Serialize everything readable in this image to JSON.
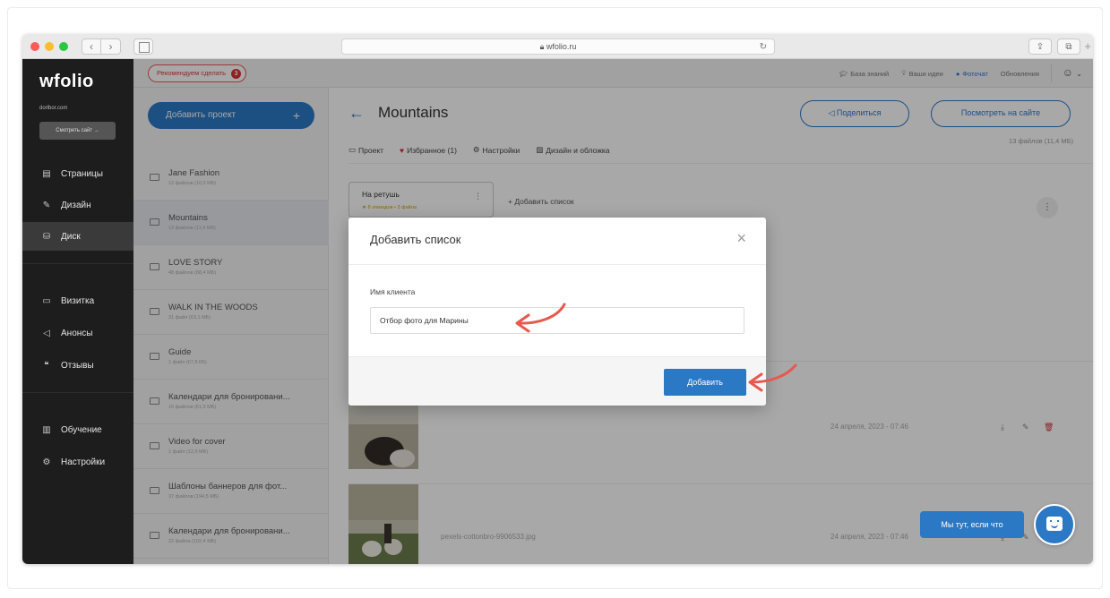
{
  "browser": {
    "url": "wfolio.ru",
    "lock_icon": "lock-icon"
  },
  "leftnav": {
    "logo": "wfolio",
    "domain": "dorlbor.com",
    "view_site": "Смотреть сайт →",
    "items": [
      {
        "label": "Страницы",
        "icon": "page-icon"
      },
      {
        "label": "Дизайн",
        "icon": "brush-icon"
      },
      {
        "label": "Диск",
        "icon": "disk-icon",
        "active": true
      },
      {
        "label": "Визитка",
        "icon": "card-icon"
      },
      {
        "label": "Анонсы",
        "icon": "megaphone-icon"
      },
      {
        "label": "Отзывы",
        "icon": "reviews-icon"
      },
      {
        "label": "Обучение",
        "icon": "book-icon"
      },
      {
        "label": "Настройки",
        "icon": "gear-icon"
      }
    ]
  },
  "header": {
    "reco_label": "Рекомендуем сделать",
    "reco_count": "3",
    "links": [
      "База знаний",
      "Ваши идеи",
      "Фоточат",
      "Обновления"
    ]
  },
  "projects": {
    "add_label": "Добавить проект",
    "add_plus": "+",
    "items": [
      {
        "name": "Jane Fashion",
        "meta": "12 файлов (10,0 МБ)"
      },
      {
        "name": "Mountains",
        "meta": "13 файлов (11,4 МБ)",
        "active": true
      },
      {
        "name": "LOVE STORY",
        "meta": "48 файлов (88,4 МБ)"
      },
      {
        "name": "WALK IN THE WOODS",
        "meta": "31 файл (63,1 МБ)"
      },
      {
        "name": "Guide",
        "meta": "1 файл (67,8 КБ)"
      },
      {
        "name": "Календари для бронировани...",
        "meta": "16 файлов (61,9 МБ)"
      },
      {
        "name": "Video for cover",
        "meta": "1 файл (12,9 МБ)"
      },
      {
        "name": "Шаблоны баннеров для фот...",
        "meta": "37 файлов (194,5 МБ)"
      },
      {
        "name": "Календари для бронировани...",
        "meta": "22 файла (102,4 МБ)"
      }
    ]
  },
  "main": {
    "back": "←",
    "title": "Mountains",
    "share": "Поделиться",
    "view_site": "Посмотреть на сайте",
    "files_count": "13 файлов (11,4 МБ)",
    "tabs": [
      {
        "label": "Проект",
        "icon": "folder-icon"
      },
      {
        "label": "Избранное (1)",
        "icon": "heart-icon"
      },
      {
        "label": "Настройки",
        "icon": "gear-icon"
      },
      {
        "label": "Дизайн и обложка",
        "icon": "image-icon"
      }
    ],
    "list_card": {
      "name": "На ретушь",
      "meta": "★ 8 эпизодов • 3 файла"
    },
    "add_list": "Добавить список",
    "rows": [
      {
        "name": "",
        "date": "24 апреля, 2023 - 07:46"
      },
      {
        "name": "pexels-cottonbro-9906533.jpg",
        "date": "24 апреля, 2023 - 07:46"
      }
    ]
  },
  "modal": {
    "title": "Добавить список",
    "close": "×",
    "field_label": "Имя клиента",
    "field_value": "Отбор фото для Марины",
    "submit": "Добавить"
  },
  "chat": {
    "pill": "Мы тут, если что"
  },
  "colors": {
    "accent": "#2b78c5",
    "danger": "#d62d3a",
    "annotation": "#e8584f"
  }
}
